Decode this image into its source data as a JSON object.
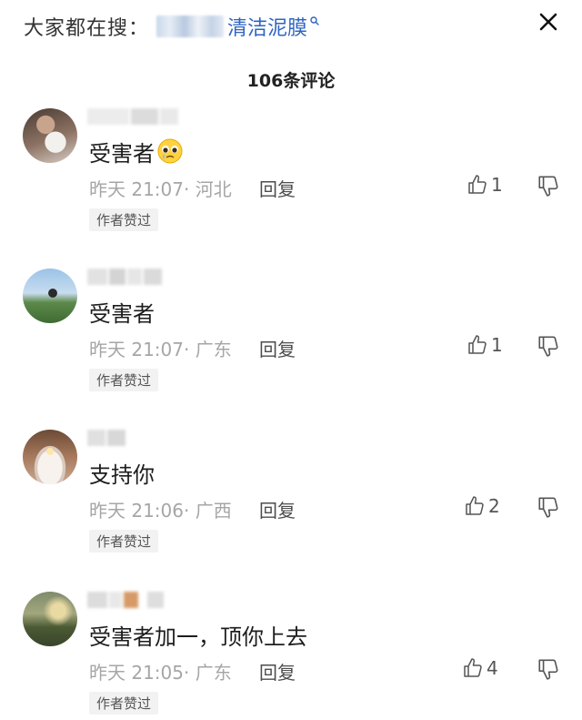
{
  "search": {
    "prefix": "大家都在搜：",
    "term": "清洁泥膜"
  },
  "comment_count": "106条评论",
  "comments": [
    {
      "text": "受害者",
      "time": "昨天 21:07",
      "location": "· 河北",
      "reply": "回复",
      "likes": "1",
      "badge": "作者赞过"
    },
    {
      "text": "受害者",
      "time": "昨天 21:07",
      "location": "· 广东",
      "reply": "回复",
      "likes": "1",
      "badge": "作者赞过"
    },
    {
      "text": "支持你",
      "time": "昨天 21:06",
      "location": "· 广西",
      "reply": "回复",
      "likes": "2",
      "badge": "作者赞过"
    },
    {
      "text": "受害者加一，顶你上去",
      "time": "昨天 21:05",
      "location": "· 广东",
      "reply": "回复",
      "likes": "4",
      "badge": "作者赞过"
    }
  ],
  "colors": {
    "search_term": "#2f64c1",
    "meta_text": "#a6a6a6",
    "badge_bg": "#f2f2f2"
  },
  "icons": [
    "search-icon",
    "close-icon",
    "thumbs-up-icon",
    "thumbs-down-icon",
    "pleading-face-emoji"
  ]
}
